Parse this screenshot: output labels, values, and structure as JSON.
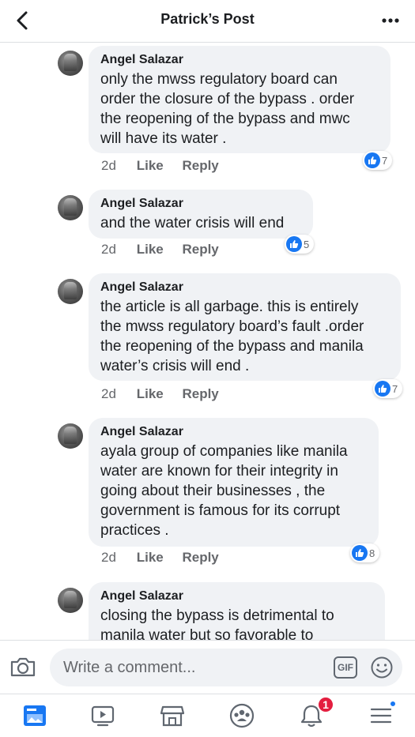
{
  "header": {
    "title": "Patrick’s Post"
  },
  "comments": [
    {
      "author": "Angel Salazar",
      "lines": [
        "only the mwss regulatory board can",
        "order the closure of the bypass . order",
        "the reopening of the bypass and mwc",
        "will have its water ."
      ],
      "time": "2d",
      "like": "Like",
      "reply": "Reply",
      "reactions": "7"
    },
    {
      "author": "Angel Salazar",
      "lines": [
        "and the water crisis will end"
      ],
      "time": "2d",
      "like": "Like",
      "reply": "Reply",
      "reactions": "5"
    },
    {
      "author": "Angel Salazar",
      "lines": [
        "the article is all garbage. this is entirely",
        "the mwss regulatory board’s fault .order",
        "the reopening of the bypass and manila",
        "water’s crisis will end ."
      ],
      "time": "2d",
      "like": "Like",
      "reply": "Reply",
      "reactions": "7"
    },
    {
      "author": "Angel Salazar",
      "lines": [
        "ayala group of companies like manila",
        "water are known for their integrity in",
        "going about their businesses , the",
        "government is famous for its corrupt",
        "practices ."
      ],
      "time": "2d",
      "like": "Like",
      "reply": "Reply",
      "reactions": "8"
    },
    {
      "author": "Angel Salazar",
      "lines": [
        "closing the bypass is detrimental to",
        "manila water but so favorable to"
      ]
    }
  ],
  "composer": {
    "placeholder": "Write a comment...",
    "gif_label": "GIF"
  },
  "tabbar": {
    "notifications_badge": "1",
    "icons": [
      "news-feed-icon",
      "watch-icon",
      "marketplace-icon",
      "groups-icon",
      "notifications-icon",
      "menu-icon"
    ]
  },
  "colors": {
    "accent": "#1877f2",
    "badge": "#e41e3f",
    "bubble": "#f0f2f5",
    "muted": "#65676b"
  }
}
